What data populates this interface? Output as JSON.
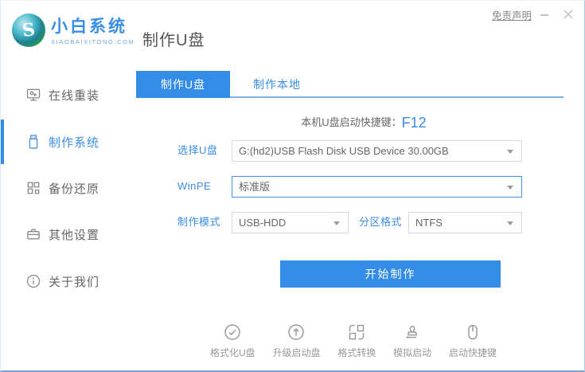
{
  "window": {
    "disclaimer": "免责声明"
  },
  "header": {
    "brand_name": "小白系统",
    "brand_domain": "XIAOBAIXITONG.COM",
    "page_title": "制作U盘"
  },
  "sidebar": {
    "items": [
      {
        "label": "在线重装",
        "icon": "monitor-icon",
        "active": false
      },
      {
        "label": "制作系统",
        "icon": "usb-drive-icon",
        "active": true
      },
      {
        "label": "备份还原",
        "icon": "grid-icon",
        "active": false
      },
      {
        "label": "其他设置",
        "icon": "briefcase-icon",
        "active": false
      },
      {
        "label": "关于我们",
        "icon": "info-icon",
        "active": false
      }
    ]
  },
  "tabs": [
    {
      "label": "制作U盘",
      "active": true
    },
    {
      "label": "制作本地",
      "active": false
    }
  ],
  "main": {
    "hotkey_label": "本机U盘启动快捷键：",
    "hotkey_value": "F12",
    "fields": {
      "usb_select": {
        "label": "选择U盘",
        "value": "G:(hd2)USB Flash Disk USB Device 30.00GB"
      },
      "winpe": {
        "label": "WinPE",
        "value": "标准版"
      },
      "mode": {
        "label": "制作模式",
        "value": "USB-HDD"
      },
      "partition": {
        "label": "分区格式",
        "value": "NTFS"
      }
    },
    "start_button": "开始制作",
    "toolbar": [
      {
        "label": "格式化U盘",
        "icon": "check-circle-icon"
      },
      {
        "label": "升级启动盘",
        "icon": "arrow-up-circle-icon"
      },
      {
        "label": "格式转换",
        "icon": "convert-icon"
      },
      {
        "label": "模拟启动",
        "icon": "stamp-icon"
      },
      {
        "label": "启动快捷键",
        "icon": "mouse-icon"
      }
    ]
  },
  "colors": {
    "accent": "#338ce5",
    "label_blue": "#3a8ee6",
    "border_gray": "#d9d9d9",
    "text_gray": "#666666",
    "muted_gray": "#999999"
  }
}
